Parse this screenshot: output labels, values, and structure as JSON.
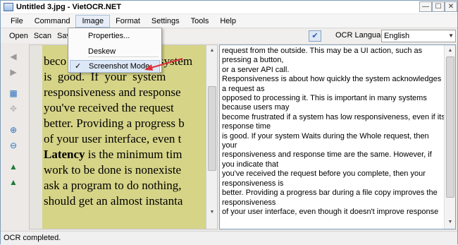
{
  "window": {
    "title": "Untitled 3.jpg - VietOCR.NET"
  },
  "menubar": {
    "items": [
      "File",
      "Command",
      "Image",
      "Format",
      "Settings",
      "Tools",
      "Help"
    ]
  },
  "toolbar": {
    "open": "Open",
    "scan": "Scan",
    "save": "Save",
    "ocr_language_label": "OCR Language",
    "ocr_language_value": "English"
  },
  "image_menu": {
    "properties": "Properties...",
    "deskew": "Deskew",
    "screenshot_mode": "Screenshot Mode",
    "screenshot_checked": true
  },
  "image_text": {
    "line1_a": "beco",
    "line1_b": "a system",
    "line2": "is  good.  If  your  system",
    "line3": "responsiveness and response",
    "line4": "you've received the request",
    "line5": "better. Providing a progress b",
    "line6": "of your user interface, even t",
    "line7_bold": "Latency",
    "line7_rest": " is the minimum tim",
    "line8": "work to be done is nonexiste",
    "line9": "ask a program to do nothing,",
    "line10": "should get an almost instanta"
  },
  "ocr_text": [
    "request from the outside. This may be a UI action, such as pressing a button,",
    "or a server API call.",
    "Responsiveness is about how quickly the system acknowledges a request as",
    "opposed to processing it. This is important in many systems because users may",
    "become frustrated if a system has low responsiveness, even if its response time",
    "is good. If your system Waits during the Whole request, then your",
    "responsiveness and response time are the same. However, if you indicate that",
    "you've received the request before you complete, then your responsiveness is",
    "better. Providing a progress bar during a file copy improves the responsiveness",
    "of your user interface, even though it doesn't improve response"
  ],
  "status": {
    "text": "OCR completed."
  },
  "colors": {
    "scanned_background": "#d6d487",
    "highlight_arrow": "#e0303a"
  }
}
